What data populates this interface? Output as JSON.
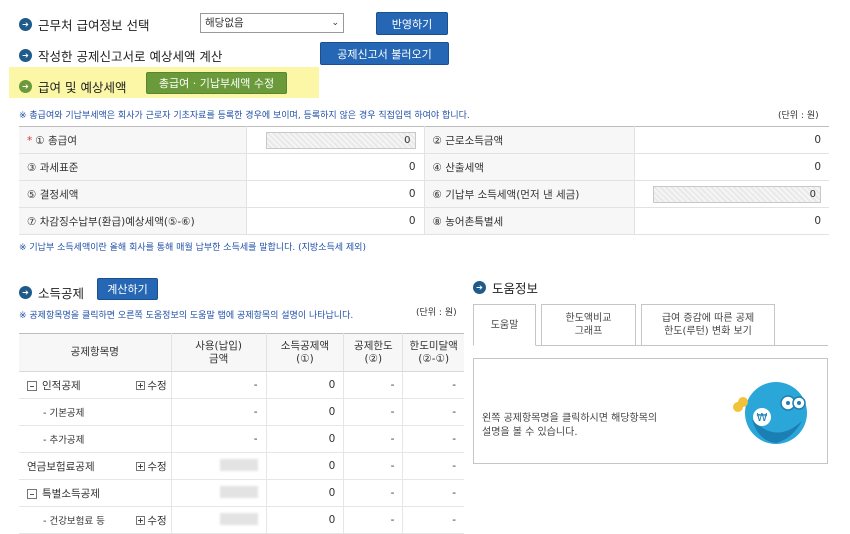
{
  "top": {
    "row1": {
      "title": "근무처 급여정보 선택",
      "select_value": "해당없음",
      "button": "반영하기"
    },
    "row2": {
      "title": "작성한 공제신고서로 예상세액 계산",
      "button": "공제신고서 불러오기"
    },
    "row3": {
      "title": "급여 및 예상세액",
      "button": "총급여 · 기납부세액 수정"
    }
  },
  "salary": {
    "note": "※ 총급여와 기납부세액은 회사가 근로자 기초자료를 등록한 경우에 보이며, 등록하지 않은 경우 직접입력 하여야 합니다.",
    "unit": "(단위 : 원)",
    "required_mark": "*",
    "rows": [
      {
        "l1": "① 총급여",
        "v1": "0",
        "l2": "② 근로소득금액",
        "v2": "0"
      },
      {
        "l1": "③ 과세표준",
        "v1": "0",
        "l2": "④ 산출세액",
        "v2": "0"
      },
      {
        "l1": "⑤ 결정세액",
        "v1": "0",
        "l2": "⑥ 기납부 소득세액(먼저 낸 세금)",
        "v2": "0"
      },
      {
        "l1": "⑦ 차감징수납부(환급)예상세액(⑤-⑥)",
        "v1": "0",
        "l2": "⑧ 농어촌특별세",
        "v2": "0"
      }
    ],
    "footnote": "※ 기납부 소득세액이란 올해 회사를 통해 매월 납부한 소득세를 말합니다. (지방소득세 제외)"
  },
  "deduction": {
    "title": "소득공제",
    "calc_button": "계산하기",
    "note": "※ 공제항목명을 클릭하면 오른쪽 도움정보의 도움말 탭에 공제항목의 설명이 나타납니다.",
    "unit": "(단위 : 원)",
    "headers": [
      "공제항목명",
      "사용(납입)\n금액",
      "소득공제액\n(①)",
      "공제한도\n(②)",
      "한도미달액\n(②-①)"
    ],
    "rows": [
      {
        "name": "인적공제",
        "expand": true,
        "edit": "수정",
        "amount": "-",
        "deduct": "0",
        "limit": "-",
        "short": "-"
      },
      {
        "name": "- 기본공제",
        "amount": "-",
        "deduct": "0",
        "limit": "-",
        "short": "-"
      },
      {
        "name": "- 추가공제",
        "amount": "-",
        "deduct": "0",
        "limit": "-",
        "short": "-"
      },
      {
        "name": "연금보험료공제",
        "edit": "수정",
        "deduct": "0",
        "limit": "-",
        "short": "-"
      },
      {
        "name": "특별소득공제",
        "expand": true,
        "deduct": "0",
        "limit": "-",
        "short": "-"
      },
      {
        "name": "- 건강보험료 등",
        "edit": "수정",
        "deduct": "0",
        "limit": "-",
        "short": "-"
      }
    ]
  },
  "help": {
    "title": "도움정보",
    "tabs": [
      "도움말",
      "한도액비교\n그래프",
      "급여 증감에 따른 공제\n한도(루턴) 변화 보기"
    ],
    "body": "왼쪽 공제항목명을 클릭하시면 해당항목의\n설명을 볼 수 있습니다."
  },
  "colors": {
    "accent": "#2567b5",
    "green": "#6a9a3a",
    "highlight": "#fbf7a6",
    "mascot": "#2aa7d8"
  }
}
